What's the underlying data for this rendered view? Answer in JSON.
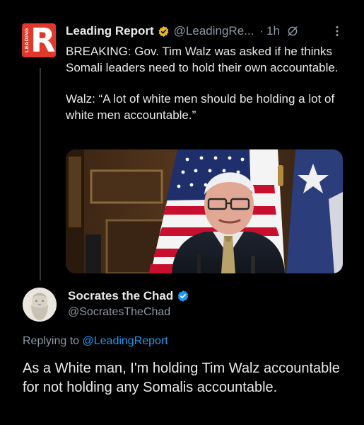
{
  "parent_tweet": {
    "avatar_text": "LEADING",
    "avatar_letter": "R",
    "display_name": "Leading Report",
    "handle": "@LeadingRe...",
    "separator": "·",
    "time": "1h",
    "paragraph_1": "BREAKING: Gov. Tim Walz was asked if he thinks Somali leaders need to hold their own accountable.",
    "paragraph_2": "Walz: “A lot of white men should be holding a lot of white men accountable.”"
  },
  "reply_tweet": {
    "display_name": "Socrates the Chad",
    "handle": "@SocratesTheChad",
    "replying_prefix": "Replying to",
    "replying_to": "@LeadingReport",
    "body": "As a White man, I'm holding Tim Walz accountable for not holding any Somalis accountable."
  },
  "colors": {
    "background": "#000000",
    "text": "#e7e9ea",
    "secondary": "#8b98a5",
    "link": "#1d9bf0",
    "verified_gold": "#e8b829",
    "verified_blue": "#1d9bf0",
    "brand_red": "#e0392b"
  },
  "icons": [
    "verified-gold-icon",
    "grok-icon",
    "more-icon",
    "verified-blue-icon"
  ]
}
